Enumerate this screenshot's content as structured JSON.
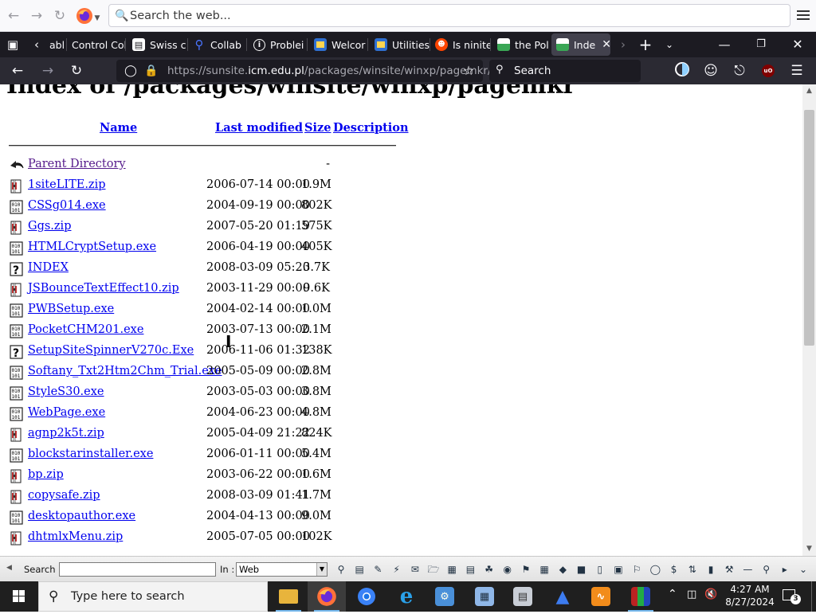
{
  "outer_toolbar": {
    "search_placeholder": "Search the web..."
  },
  "tabs": [
    {
      "label": "abl",
      "favicon": "partial",
      "color": "#1c1b22"
    },
    {
      "label": "Control Col",
      "favicon": "none",
      "color": "#1c1b22"
    },
    {
      "label": "Swiss c",
      "favicon": "doc-icon",
      "color": "#ffffff"
    },
    {
      "label": "Collab",
      "favicon": "search-icon",
      "color": "#4a74ff"
    },
    {
      "label": "Problei",
      "favicon": "info-icon",
      "color": "#ffffff"
    },
    {
      "label": "Welcor",
      "favicon": "window-icon",
      "color": "#2f6fd0"
    },
    {
      "label": "Utilities",
      "favicon": "window-icon",
      "color": "#2f6fd0"
    },
    {
      "label": "Is ninite",
      "favicon": "reddit-icon",
      "color": "#ff4500"
    },
    {
      "label": "the Pol",
      "favicon": "image-icon",
      "color": "#3aa655"
    },
    {
      "label": "Inde",
      "favicon": "image-icon",
      "color": "#3aa655",
      "active": true
    }
  ],
  "navbar": {
    "url_prefix": "https://sunsite.",
    "url_domain": "icm.edu.pl",
    "url_path": "/packages/winsite/winxp/pagemkr/",
    "search_label": "Search"
  },
  "page": {
    "title": "Index of /packages/winsite/winxp/pagemkr",
    "headers": {
      "name": "Name",
      "last_modified": "Last modified",
      "size": "Size",
      "description": "Description"
    },
    "rows": [
      {
        "icon": "back",
        "name": "Parent Directory",
        "date": "",
        "size": "-",
        "visited": true
      },
      {
        "icon": "compressed",
        "name": "1siteLITE.zip",
        "date": "2006-07-14 00:00",
        "size": "1.9M"
      },
      {
        "icon": "binary",
        "name": "CSSg014.exe",
        "date": "2004-09-19 00:00",
        "size": "802K"
      },
      {
        "icon": "compressed",
        "name": "Ggs.zip",
        "date": "2007-05-20 01:19",
        "size": "575K"
      },
      {
        "icon": "binary",
        "name": "HTMLCryptSetup.exe",
        "date": "2006-04-19 00:00",
        "size": "405K"
      },
      {
        "icon": "unknown",
        "name": "INDEX",
        "date": "2008-03-09 05:20",
        "size": "3.7K"
      },
      {
        "icon": "compressed",
        "name": "JSBounceTextEffect10.zip",
        "date": "2003-11-29 00:00",
        "size": "9.6K"
      },
      {
        "icon": "binary",
        "name": "PWBSetup.exe",
        "date": "2004-02-14 00:00",
        "size": "1.0M"
      },
      {
        "icon": "binary",
        "name": "PocketCHM201.exe",
        "date": "2003-07-13 00:00",
        "size": "2.1M"
      },
      {
        "icon": "unknown",
        "name": "SetupSiteSpinnerV270c.Exe",
        "date": "2006-11-06 01:32",
        "size": "138K"
      },
      {
        "icon": "binary",
        "name": "Softany_Txt2Htm2Chm_Trial.exe",
        "date": "2005-05-09 00:00",
        "size": "2.8M"
      },
      {
        "icon": "binary",
        "name": "StyleS30.exe",
        "date": "2003-05-03 00:00",
        "size": "3.8M"
      },
      {
        "icon": "binary",
        "name": "WebPage.exe",
        "date": "2004-06-23 00:00",
        "size": "4.8M"
      },
      {
        "icon": "compressed",
        "name": "agnp2k5t.zip",
        "date": "2005-04-09 21:22",
        "size": "824K"
      },
      {
        "icon": "binary",
        "name": "blockstarinstaller.exe",
        "date": "2006-01-11 00:00",
        "size": "5.4M"
      },
      {
        "icon": "compressed",
        "name": "bp.zip",
        "date": "2003-06-22 00:00",
        "size": "1.6M"
      },
      {
        "icon": "compressed",
        "name": "copysafe.zip",
        "date": "2008-03-09 01:41",
        "size": "1.7M"
      },
      {
        "icon": "binary",
        "name": "desktopauthor.exe",
        "date": "2004-04-13 00:00",
        "size": "9.0M"
      },
      {
        "icon": "compressed",
        "name": "dhtmlxMenu.zip",
        "date": "2005-07-05 00:00",
        "size": "102K"
      }
    ]
  },
  "addon_bar": {
    "search_label": "Search :",
    "search_value": "",
    "in_label": "In :",
    "in_value": "Web"
  },
  "taskbar": {
    "search_placeholder": "Type here to search",
    "time": "4:27 AM",
    "date": "8/27/2024",
    "notification_count": "3"
  }
}
